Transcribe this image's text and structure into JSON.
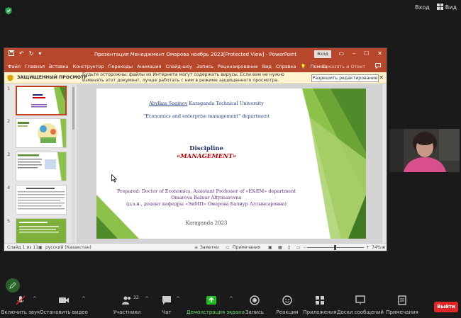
{
  "zoom": {
    "top_right": {
      "signin_label": "Вход",
      "view_label": "Вид"
    },
    "toolbar": {
      "mute_label": "Включить звук",
      "video_label": "Остановить видео",
      "participants_label": "Участники",
      "participants_count": "33",
      "chat_label": "Чат",
      "share_label": "Демонстрация экрана",
      "record_label": "Запись",
      "reactions_label": "Реакции",
      "apps_label": "Приложения",
      "whiteboard_label": "Доски сообщений",
      "notes_label": "Примечания",
      "leave_label": "Выйти"
    }
  },
  "ppt": {
    "window_title": "Презентация Менеджмент Омарова ноябрь 2023[Protected View] - PowerPoint",
    "signin_label": "Вход",
    "ribbon_tabs": [
      "Файл",
      "Главная",
      "Вставка",
      "Конструктор",
      "Переходы",
      "Анимация",
      "Слайд-шоу",
      "Запись",
      "Рецензирование",
      "Вид",
      "Справка"
    ],
    "help_label": "Помощ",
    "share_label": "Показать и Ответ",
    "protected_view": {
      "label": "ЗАЩИЩЕННЫЙ ПРОСМОТР",
      "message": "Будьте осторожны: файлы из Интернета могут содержать вирусы. Если вам не нужно изменять этот документ, лучше работать с ним в режиме защищенного просмотра.",
      "enable_button": "Разрешить редактирование"
    },
    "thumbnails": [
      "1",
      "2",
      "3",
      "4",
      "5"
    ],
    "slide": {
      "line1_author": "Abylkas Saginov",
      "line1_rest": " Karaganda Technical University",
      "line2": "\"Economics and enterprise management\" department",
      "discipline": "Discipline",
      "course": "«MANAGEMENT»",
      "prepared": "Prepared: Doctor of Economics, Assistant Professor of «E&EM» department",
      "name_en": "Omarova Balnur Altynsarovna",
      "name_ru": "(д.э.н., доцент кафедры «ЭиМП» Омарова Балнур Алтынсаровна)",
      "city_year": "Karaganda 2023"
    },
    "status": {
      "slide_count": "Слайд 1 из 11",
      "language": "русский (Казахстан)",
      "notes_label": "Заметки",
      "comments_label": "Примечания",
      "zoom": "74%"
    }
  },
  "colors": {
    "ppt_accent": "#b7472a",
    "leave": "#e02828",
    "share_green": "#23c123",
    "slide_green": "#7fb13a"
  }
}
